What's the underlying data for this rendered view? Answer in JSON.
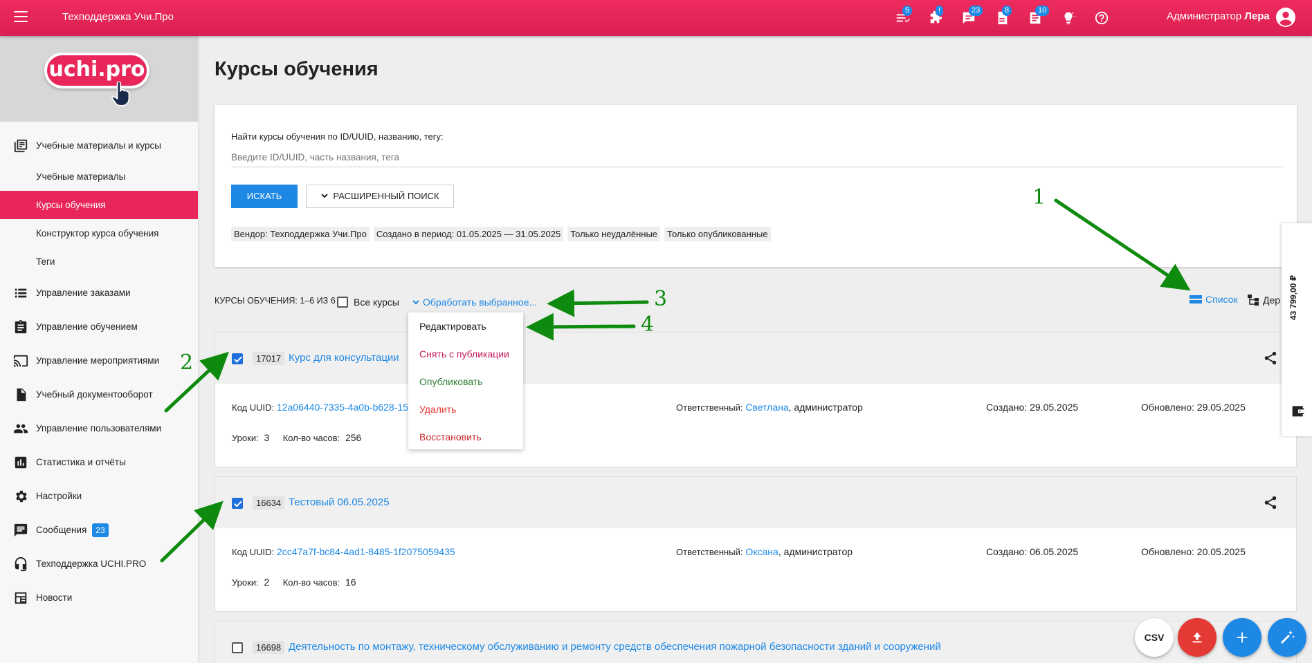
{
  "topbar": {
    "app_title": "Техподдержка Учи.Про",
    "badges": [
      "5",
      "!",
      "23",
      "8",
      "10"
    ],
    "admin_label": "Администратор",
    "admin_name": "Лера"
  },
  "sidebar": {
    "logo": "uchi.pro",
    "sections": [
      {
        "label": "Учебные материалы и курсы"
      },
      {
        "label": "Учебные материалы"
      },
      {
        "label": "Курсы обучения"
      },
      {
        "label": "Конструктор курса обучения"
      },
      {
        "label": "Теги"
      },
      {
        "label": "Управление заказами"
      },
      {
        "label": "Управление обучением"
      },
      {
        "label": "Управление мероприятиями"
      },
      {
        "label": "Учебный документооборот"
      },
      {
        "label": "Управление пользователями"
      },
      {
        "label": "Статистика и отчёты"
      },
      {
        "label": "Настройки"
      },
      {
        "label": "Сообщения",
        "badge": "23"
      },
      {
        "label": "Техподдержка UCHI.PRO"
      },
      {
        "label": "Новости"
      }
    ]
  },
  "page": {
    "title": "Курсы обучения"
  },
  "search": {
    "label": "Найти курсы обучения по ID/UUID, названию, тегу:",
    "placeholder": "Введите ID/UUID, часть названия, тега",
    "search_button": "ИСКАТЬ",
    "advanced_button": "РАСШИРЕННЫЙ ПОИСК",
    "chips": [
      "Вендор: Техподдержка Учи.Про",
      "Создано в период: 01.05.2025 — 31.05.2025",
      "Только неудалённые",
      "Только опубликованные"
    ]
  },
  "list": {
    "header": "КУРСЫ ОБУЧЕНИЯ: 1–6 ИЗ 6",
    "all_courses": "Все курсы",
    "process_selected": "Обработать выбранное...",
    "view_list": "Список",
    "view_tree": "Дер"
  },
  "dropdown": {
    "items": [
      {
        "label": "Редактировать",
        "color": "#222222"
      },
      {
        "label": "Снять с публикации",
        "color": "#c2185b"
      },
      {
        "label": "Опубликовать",
        "color": "#2e7d32"
      },
      {
        "label": "Удалить",
        "color": "#e53935"
      },
      {
        "label": "Восстановить",
        "color": "#c62828"
      }
    ]
  },
  "courses": [
    {
      "checked": true,
      "id": "17017",
      "name": "Курс для консультации",
      "uuid_label": "Код UUID:",
      "uuid": "12a06440-7335-4a0b-b628-15",
      "resp_label": "Ответственный:",
      "resp_name": "Светлана",
      "resp_role": ", администратор",
      "created": "Создано: 29.05.2025",
      "updated": "Обновлено: 29.05.2025",
      "lessons_label": "Уроки:",
      "lessons": "3",
      "hours_label": "Кол-во часов:",
      "hours": "256"
    },
    {
      "checked": true,
      "id": "16634",
      "name": "Тестовый 06.05.2025",
      "uuid_label": "Код UUID:",
      "uuid": "2cc47a7f-bc84-4ad1-8485-1f2075059435",
      "resp_label": "Ответственный:",
      "resp_name": "Оксана",
      "resp_role": ", администратор",
      "created": "Создано: 06.05.2025",
      "updated": "Обновлено: 20.05.2025",
      "lessons_label": "Уроки:",
      "lessons": "2",
      "hours_label": "Кол-во часов:",
      "hours": "16"
    },
    {
      "checked": false,
      "id": "16698",
      "name": "Деятельность по монтажу, техническому обслуживанию и ремонту средств обеспечения пожарной безопасности зданий и сооружений"
    }
  ],
  "side_panel": {
    "amount": "43 799,00 ₽"
  },
  "fabs": {
    "csv": "CSV"
  },
  "annotations": [
    "1",
    "2",
    "3",
    "4"
  ],
  "colors": {
    "brand": "#e8265a",
    "accent": "#1e88e5",
    "annotation": "#0e8a0e"
  }
}
